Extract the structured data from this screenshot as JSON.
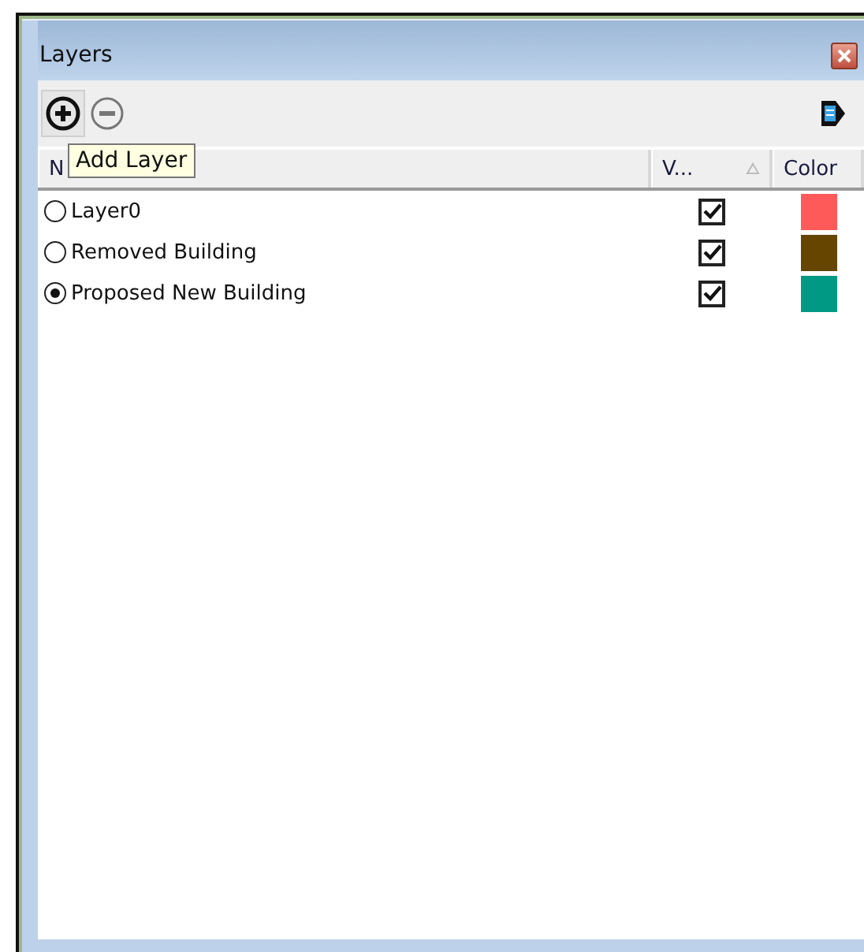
{
  "window": {
    "title": "Layers"
  },
  "toolbar": {
    "tooltip": "Add Layer"
  },
  "table": {
    "columns": [
      "N",
      "V...",
      "Color"
    ],
    "rows": [
      {
        "name": "Layer0",
        "selected": false,
        "visible": true,
        "color": "#ff5a5a"
      },
      {
        "name": "Removed Building",
        "selected": false,
        "visible": true,
        "color": "#654500"
      },
      {
        "name": "Proposed New Building",
        "selected": true,
        "visible": true,
        "color": "#009a84"
      }
    ]
  }
}
